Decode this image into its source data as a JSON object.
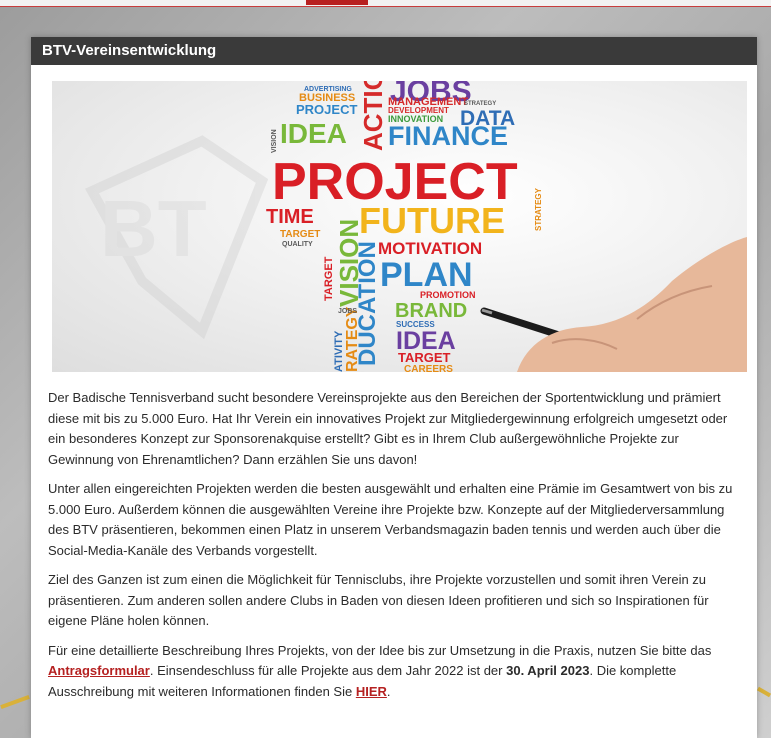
{
  "panel": {
    "title": "BTV-Vereinsentwicklung"
  },
  "hero": {
    "logo_text": "BT",
    "words": {
      "jobs": "JOBS",
      "advertising": "ADVERTISING",
      "business": "BUSINESS",
      "project_small": "PROJECT",
      "management": "MANAGEMENT",
      "strategy_small": "STRATEGY",
      "development": "DEVELOPMENT",
      "innovation": "INNOVATION",
      "data": "DATA",
      "idea": "IDEA",
      "action": "ACTIO",
      "finance": "FINANCE",
      "vision_small": "VISION",
      "project": "PROJECT",
      "time": "TIME",
      "target": "TARGET",
      "quality": "QUALITY",
      "future": "FUTURE",
      "strategy_side": "STRATEGY",
      "motivation": "MOTIVATION",
      "vision": "VISION",
      "plan": "PLAN",
      "target_vertical": "TARGET",
      "promotion": "PROMOTION",
      "brand": "BRAND",
      "education": "DUCATION",
      "success": "SUCCESS",
      "idea_bottom": "IDEA",
      "strategy_bottom": "RATEGY",
      "activity": "ATIVITY",
      "target_bottom": "TARGET",
      "careers": "CAREERS",
      "jobs_small": "JOBS"
    }
  },
  "article": {
    "p1": "Der Badische Tennisverband sucht besondere Vereinsprojekte aus den Bereichen der Sportentwicklung und prämiert diese mit bis zu 5.000 Euro. Hat Ihr Verein ein innovatives Projekt zur Mitgliedergewinnung erfolgreich umgesetzt oder ein besonderes Konzept zur Sponsorenakquise erstellt? Gibt es in Ihrem Club außergewöhnliche Projekte zur Gewinnung von Ehrenamtlichen? Dann erzählen Sie uns davon!",
    "p2": "Unter allen eingereichten Projekten werden die besten ausgewählt und erhalten eine Prämie im Gesamtwert von bis zu 5.000 Euro. Außerdem können die ausgewählten Vereine ihre Projekte bzw. Konzepte auf der Mitgliederversammlung des BTV präsentieren, bekommen einen Platz in unserem Verbandsmagazin baden tennis und werden auch über die Social-Media-Kanäle des Verbands vorgestellt.",
    "p3": "Ziel des Ganzen ist zum einen die Möglichkeit für Tennisclubs, ihre Projekte vorzustellen und somit ihren Verein zu präsentieren. Zum anderen sollen andere Clubs in Baden von diesen Ideen profitieren und sich so Inspirationen für eigene Pläne holen können.",
    "p4_a": "Für eine detaillierte Beschreibung Ihres Projekts, von der Idee bis zur Umsetzung in die Praxis, nutzen Sie bitte das ",
    "p4_link": "Antragsformular",
    "p4_b": ". Einsendeschluss für alle Projekte aus dem Jahr 2022 ist der ",
    "p4_date": "30. April 2023",
    "p4_c": ". Die komplette Ausschreibung mit weiteren Informationen finden Sie ",
    "p4_link2": "HIER",
    "p4_d": "."
  }
}
